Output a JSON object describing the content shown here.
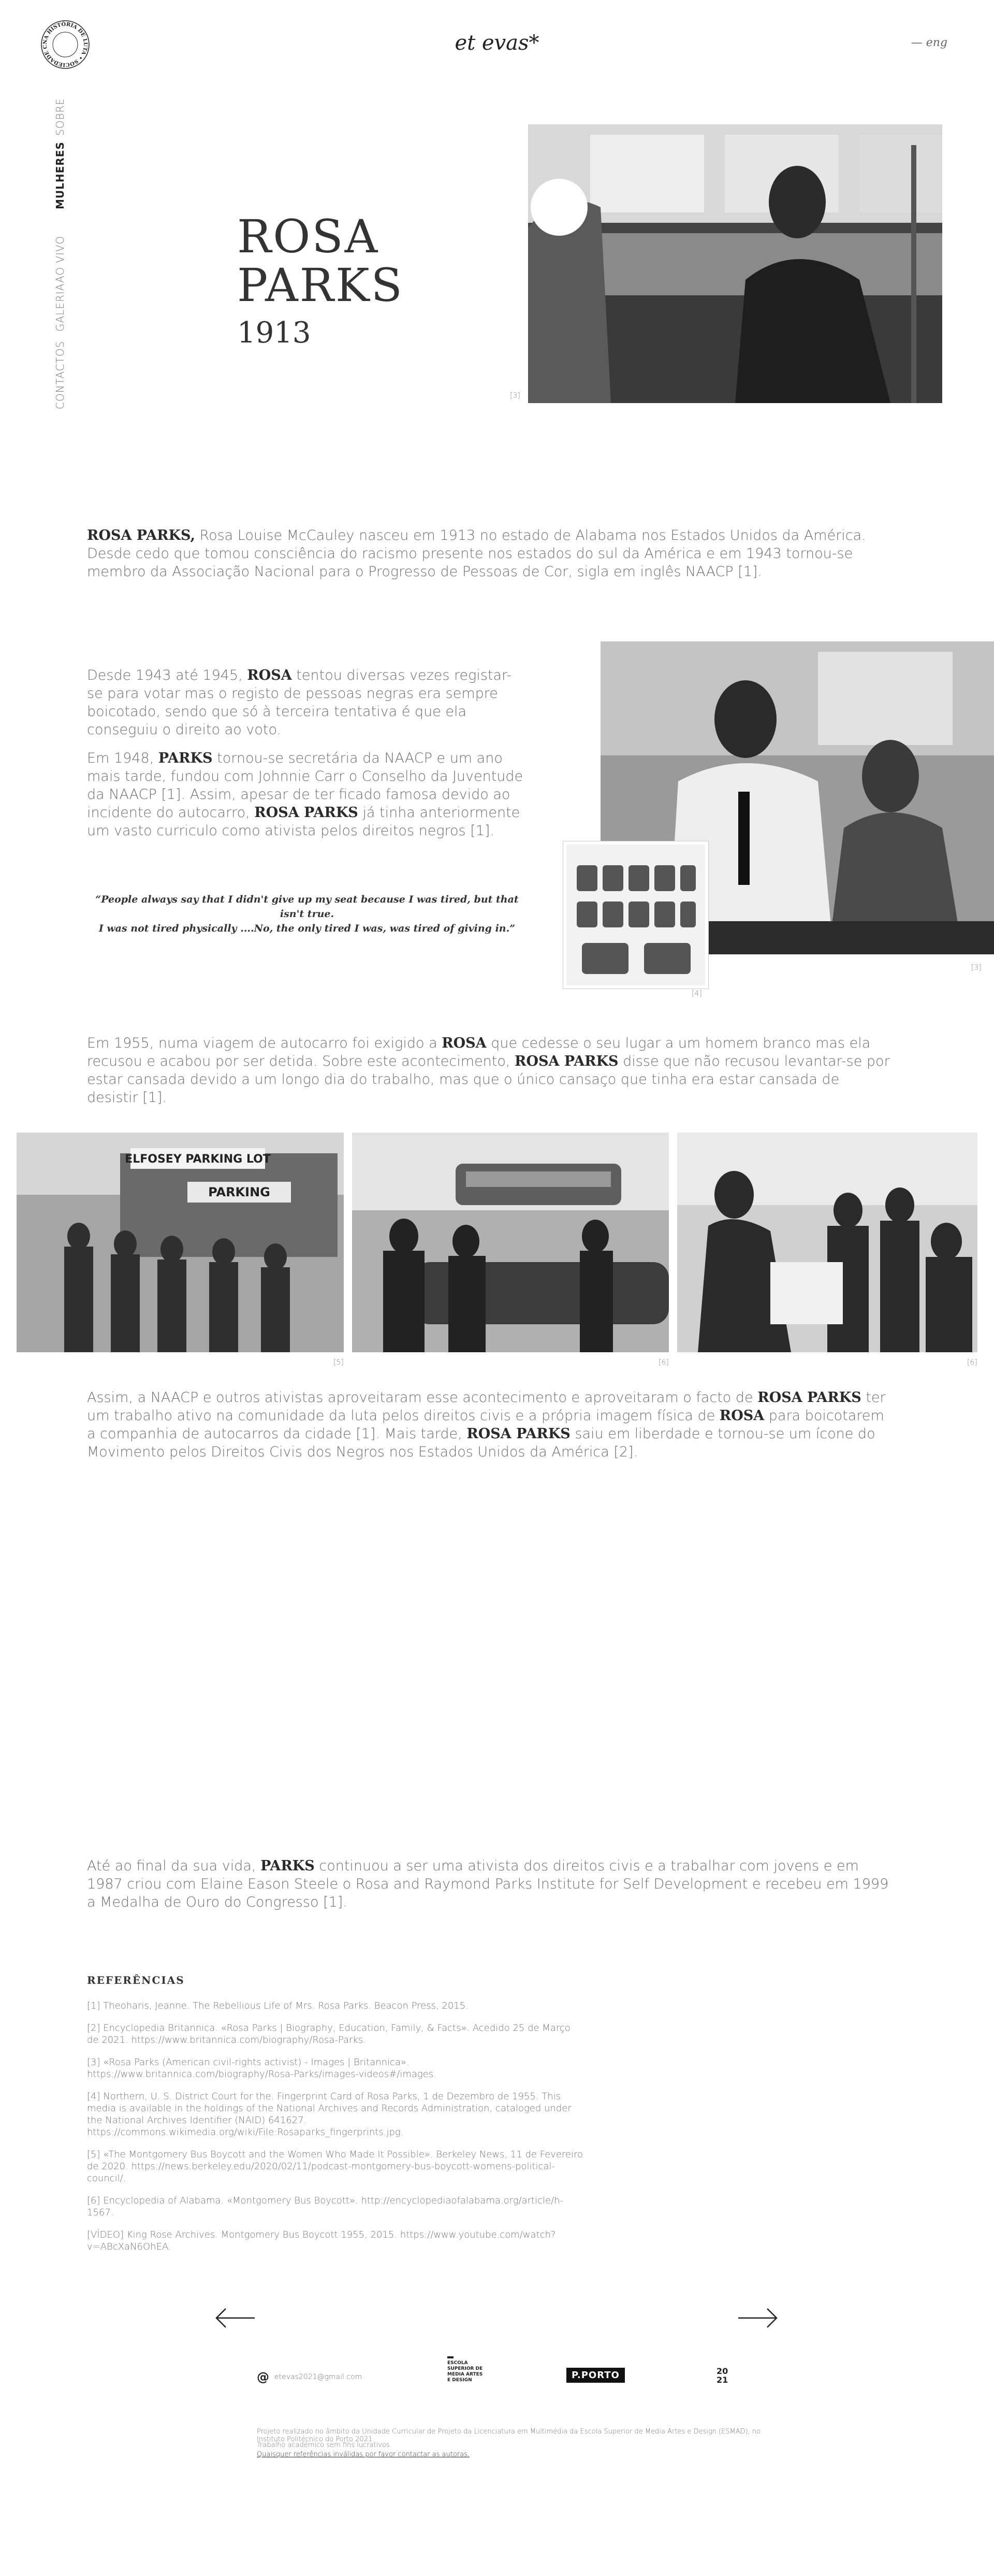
{
  "header": {
    "brand": "et evas*",
    "lang": "— eng",
    "seal_text": "NA HISTÓRIA DE LUTA • SOCIEDADE CIVIL •"
  },
  "nav": [
    {
      "label": "SOBRE"
    },
    {
      "label": "MULHERES"
    },
    {
      "label": "AO VIVO"
    },
    {
      "label": "GALERIA"
    },
    {
      "label": "CONTACTOS"
    }
  ],
  "hero": {
    "name_line1": "ROSA",
    "name_line2": "PARKS",
    "year": "1913",
    "photo_ref": "[3]"
  },
  "intro": {
    "strong": "ROSA PARKS,",
    "text": " Rosa Louise McCauley nasceu em 1913 no estado de Alabama nos Estados Unidos da América. Desde cedo que tomou consciência do racismo presente nos estados do sul da América e em 1943 tornou-se membro da Associação Nacional para o Progresso de Pessoas de Cor, sigla em inglês NAACP [1]."
  },
  "section2": {
    "p1_a": "Desde 1943 até 1945, ",
    "p1_strong": "ROSA",
    "p1_b": " tentou diversas vezes registar-se para votar mas o registo de pessoas negras era sempre boicotado, sendo que só à terceira tentativa é que ela conseguiu o direito ao voto.",
    "p2_a": "Em 1948, ",
    "p2_strong1": "PARKS",
    "p2_b": " tornou-se secretária da NAACP e um ano mais tarde, fundou com Johnnie Carr o Conselho da Juventude da NAACP [1]. Assim, apesar de ter ficado famosa devido ao incidente do autocarro, ",
    "p2_strong2": "ROSA PARKS",
    "p2_c": " já tinha anteriormente um vasto curriculo como ativista pelos direitos negros [1].",
    "quote_line1": "“People always say that I didn't give up my seat because I was tired, but that isn't true.",
    "quote_line2": "I was not tired physically ....No, the only tired I was, was tired of giving in.”",
    "ref_fingerprint": "[4]",
    "ref_photo": "[3]"
  },
  "section3": {
    "a": "Em 1955, numa viagem de autocarro foi exigido a ",
    "strong1": "ROSA",
    "b": " que cedesse o seu lugar a um homem branco mas ela recusou e acabou por ser detida. Sobre este acontecimento, ",
    "strong2": "ROSA PARKS",
    "c": " disse que não recusou levantar-se por estar cansada devido a um longo dia do trabalho, mas que o único cansaço que tinha era estar cansada de desistir [1]."
  },
  "gallery": {
    "sign1": "ELFOSEY PARKING LOT",
    "sign2": "PARKING",
    "refs": [
      "[5]",
      "[6]",
      "[6]"
    ]
  },
  "section4": {
    "a": "Assim, a NAACP e outros ativistas aproveitaram esse acontecimento e aproveitaram o facto de ",
    "strong1": "ROSA PARKS",
    "b": " ter um trabalho ativo na comunidade da luta pelos direitos civis e a própria imagem física de ",
    "strong2": "ROSA",
    "c": " para boicotarem a companhia de autocarros da cidade [1]. Mais tarde, ",
    "strong3": "ROSA PARKS",
    "d": " saiu em liberdade e tornou-se um ícone do Movimento pelos Direitos Civis dos Negros nos Estados Unidos da América [2]."
  },
  "section5": {
    "a": "Até ao final da sua vida, ",
    "strong": "PARKS",
    "b": " continuou a ser uma ativista dos direitos civis e a trabalhar com jovens e em 1987 criou com Elaine Eason Steele o Rosa and Raymond Parks Institute for Self Development e recebeu em 1999 a Medalha de Ouro do Congresso [1]."
  },
  "references": {
    "title": "REFERÊNCIAS",
    "items": [
      "[1] Theoharis, Jeanne. The Rebellious Life of Mrs. Rosa Parks. Beacon Press, 2015.",
      "[2] Encyclopedia Britannica. «Rosa Parks | Biography, Education, Family, & Facts». Acedido 25 de Março de 2021. https://www.britannica.com/biography/Rosa-Parks.",
      "[3] «Rosa Parks (American civil-rights activist) - Images | Britannica». https://www.britannica.com/biography/Rosa-Parks/images-videos#/images.",
      "[4] Northern, U. S. District Court for the. Fingerprint Card of Rosa Parks, 1 de Dezembro de 1955. This media is available in the holdings of the National Archives and Records Administration, cataloged under the National Archives Identifier (NAID) 641627. https://commons.wikimedia.org/wiki/File:Rosaparks_fingerprints.jpg.",
      "[5] «The Montgomery Bus Boycott and the Women Who Made It Possible». Berkeley News, 11 de Fevereiro de 2020. https://news.berkeley.edu/2020/02/11/podcast-montgomery-bus-boycott-womens-political-council/.",
      "[6] Encyclopedia of Alabama. «Montgomery Bus Boycott». http://encyclopediaofalabama.org/article/h-1567.",
      "[VÍDEO] King Rose Archives. Montgomery Bus Boycott 1955, 2015. https://www.youtube.com/watch?v=ABcXaN6OhEA."
    ]
  },
  "footer": {
    "email": "etevas2021@gmail.com",
    "school": "ESCOLA SUPERIOR DE MEDIA ARTES E DESIGN",
    "porto": "P.PORTO",
    "year_top": "20",
    "year_bottom": "21",
    "note1": "Projeto realizado no âmbito da Unidade Curricular de Projeto da Licenciatura em Multimédia da Escola Superior de Media Artes e Design (ESMAD), no Instituto Politécnico do Porto 2021.",
    "note2": "Trabalho académico sem fins lucrativos.",
    "note3": "Quaisquer referências inválidas por favor contactar as autoras."
  }
}
